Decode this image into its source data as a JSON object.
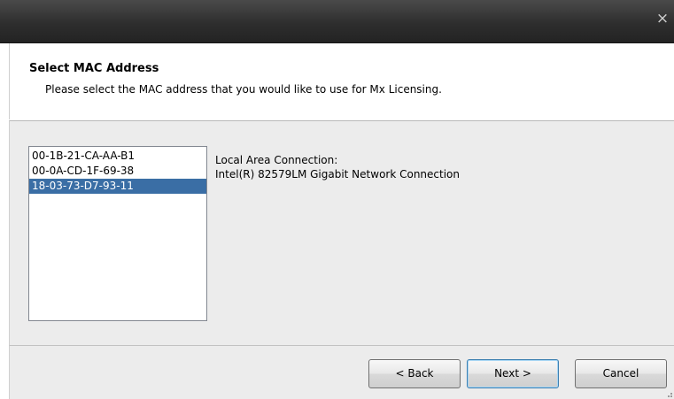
{
  "titlebar": {
    "close_label": "×"
  },
  "header": {
    "title": "Select MAC Address",
    "subtitle": "Please select the MAC address that you would like to use for Mx Licensing."
  },
  "mac_list": {
    "items": [
      {
        "label": "00-1B-21-CA-AA-B1",
        "selected": false
      },
      {
        "label": "00-0A-CD-1F-69-38",
        "selected": false
      },
      {
        "label": "18-03-73-D7-93-11",
        "selected": true
      }
    ]
  },
  "connection": {
    "name": "Local Area Connection:",
    "adapter": "Intel(R) 82579LM Gigabit Network Connection"
  },
  "buttons": {
    "back": "< Back",
    "next": "Next >",
    "cancel": "Cancel"
  },
  "colors": {
    "titlebar": "#2e2e2e",
    "selection": "#3a6ea5",
    "panel": "#ececec"
  }
}
